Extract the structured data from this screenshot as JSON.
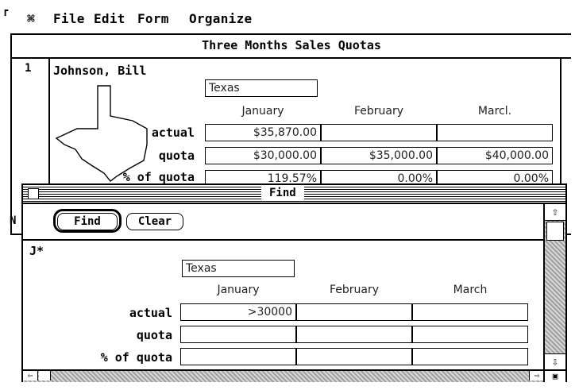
{
  "menubar": {
    "apple_icon": "apple-icon",
    "items": [
      "File",
      "Edit",
      "Form",
      "Organize"
    ]
  },
  "back_window": {
    "title": "Three Months Sales Quotas",
    "record_number": "1",
    "name": "Johnson, Bill",
    "state_field": "Texas",
    "columns": [
      "January",
      "February",
      "Marcl."
    ],
    "rows": [
      {
        "label": "actual",
        "values": [
          "$35,870.00",
          "",
          ""
        ]
      },
      {
        "label": "quota",
        "values": [
          "$30,000.00",
          "$35,000.00",
          "$40,000.00"
        ]
      },
      {
        "label": "% of quota",
        "values": [
          "119.57%",
          "0.00%",
          "0.00%"
        ]
      }
    ],
    "left_edge_label": "N"
  },
  "find_window": {
    "title": "Find",
    "find_button": "Find",
    "clear_button": "Clear",
    "query_text": "J*",
    "state_field": "Texas",
    "columns": [
      "January",
      "February",
      "March"
    ],
    "rows": [
      {
        "label": "actual",
        "values": [
          ">30000",
          "",
          ""
        ]
      },
      {
        "label": "quota",
        "values": [
          "",
          "",
          ""
        ]
      },
      {
        "label": "% of quota",
        "values": [
          "",
          "",
          ""
        ]
      }
    ]
  },
  "colors": {
    "foreground": "#000000",
    "background": "#ffffff",
    "scroll_pattern": "#a0a0a0"
  }
}
